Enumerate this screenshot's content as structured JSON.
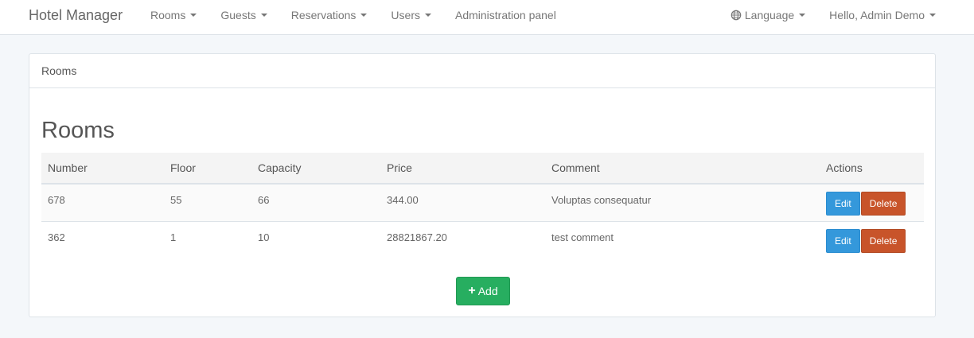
{
  "navbar": {
    "brand": "Hotel Manager",
    "left_items": [
      {
        "label": "Rooms",
        "dropdown": true
      },
      {
        "label": "Guests",
        "dropdown": true
      },
      {
        "label": "Reservations",
        "dropdown": true
      },
      {
        "label": "Users",
        "dropdown": true
      },
      {
        "label": "Administration panel",
        "dropdown": false
      }
    ],
    "language_label": "Language",
    "user_label": "Hello, Admin Demo"
  },
  "panel": {
    "heading": "Rooms",
    "title": "Rooms"
  },
  "table": {
    "headers": [
      "Number",
      "Floor",
      "Capacity",
      "Price",
      "Comment",
      "Actions"
    ],
    "rows": [
      {
        "number": "678",
        "floor": "55",
        "capacity": "66",
        "price": "344.00",
        "comment": "Voluptas consequatur"
      },
      {
        "number": "362",
        "floor": "1",
        "capacity": "10",
        "price": "28821867.20",
        "comment": "test comment"
      }
    ],
    "edit_label": "Edit",
    "delete_label": "Delete"
  },
  "add_label": "Add",
  "colors": {
    "edit": "#3498db",
    "delete": "#c8542a",
    "add": "#27ae60"
  },
  "icons": [
    "globe-icon",
    "plus-icon",
    "caret-down-icon"
  ]
}
